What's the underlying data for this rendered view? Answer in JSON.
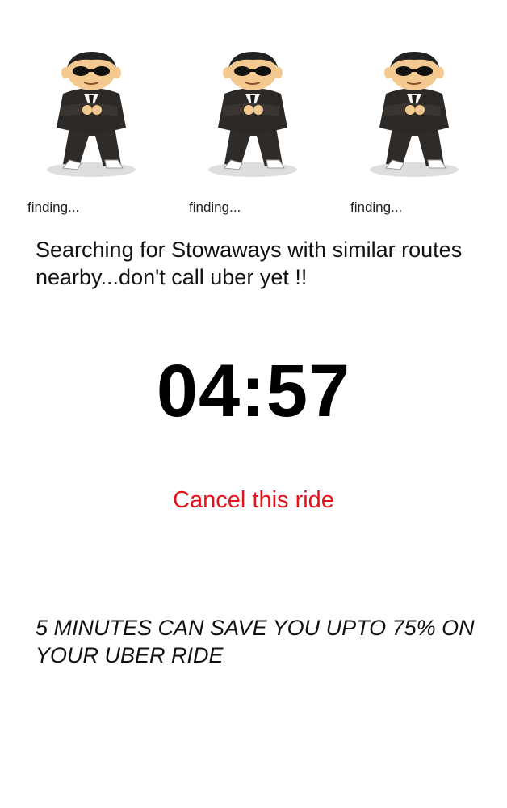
{
  "searching_slots": [
    {
      "status": "finding..."
    },
    {
      "status": "finding..."
    },
    {
      "status": "finding..."
    }
  ],
  "message": "Searching for Stowaways with similar routes nearby...don't call uber yet !!",
  "countdown": "04:57",
  "cancel_label": "Cancel this ride",
  "promo": "5 MINUTES CAN SAVE YOU UPTO 75% ON YOUR UBER RIDE",
  "colors": {
    "cancel": "#e2141b",
    "suit": "#2b2825",
    "skin": "#f3c98f"
  }
}
